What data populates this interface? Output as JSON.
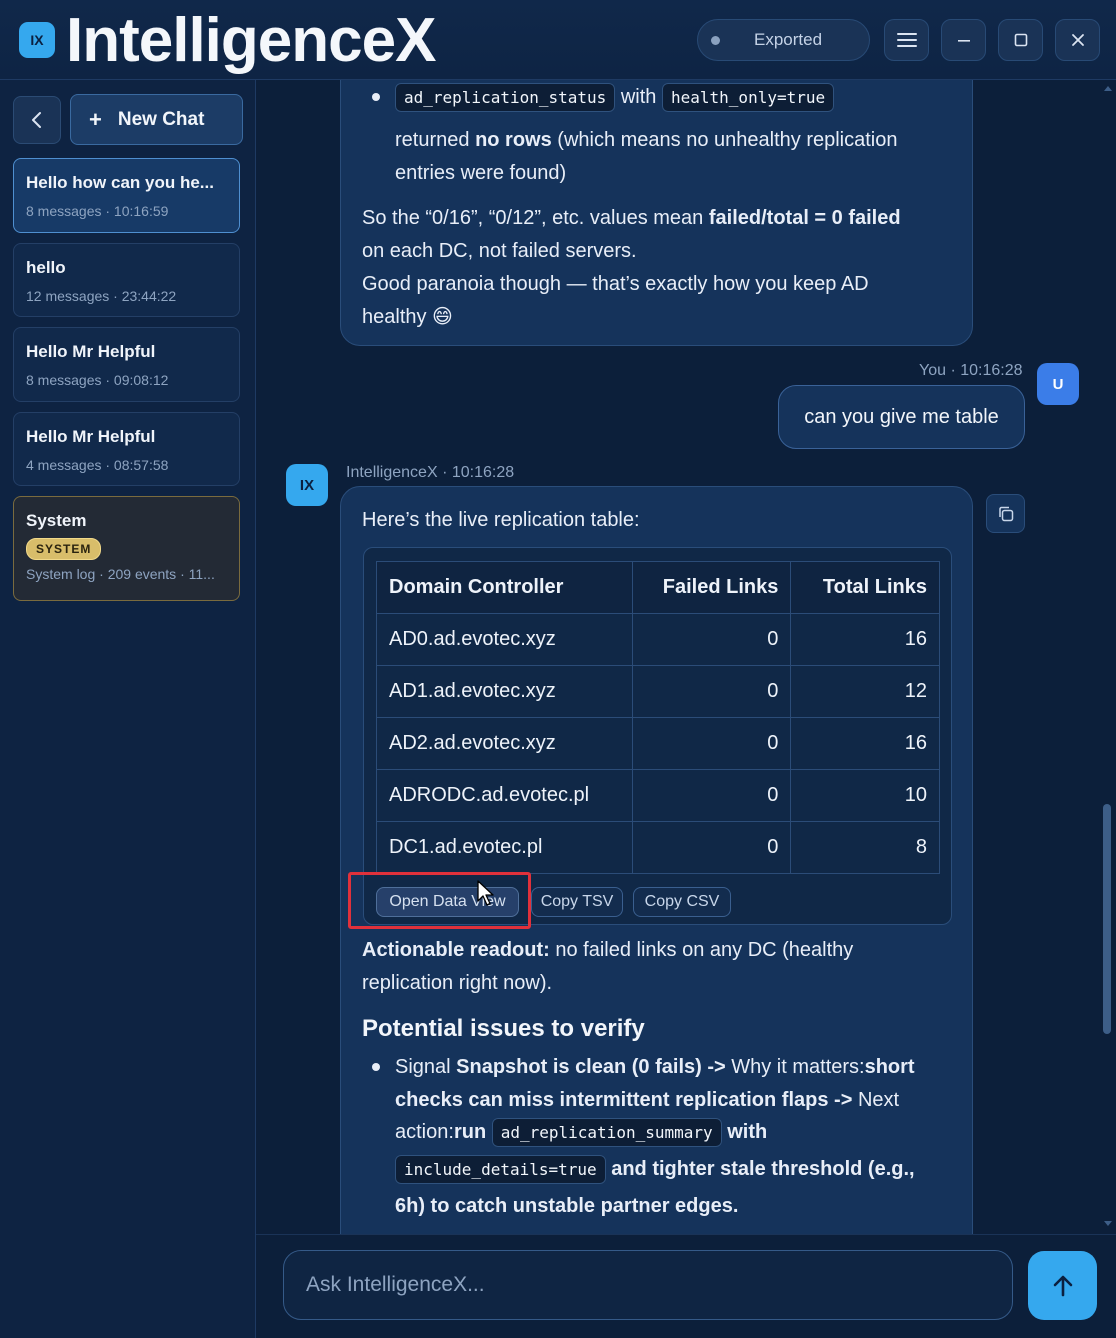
{
  "app": {
    "logo_text": "IX",
    "title": "IntelligenceX"
  },
  "status": {
    "label": "Exported"
  },
  "sidebar": {
    "new_chat_label": "New Chat",
    "items": [
      {
        "title": "Hello how can you he...",
        "meta": "8 messages · 10:16:59"
      },
      {
        "title": "hello",
        "meta": "12 messages · 23:44:22"
      },
      {
        "title": "Hello Mr Helpful",
        "meta": "8 messages · 09:08:12"
      },
      {
        "title": "Hello Mr Helpful",
        "meta": "4 messages · 08:57:58"
      },
      {
        "title": "System",
        "badge": "SYSTEM",
        "meta": "System log · 209 events · 11..."
      }
    ]
  },
  "messages": {
    "prev": {
      "code1": "ad_replication_status",
      "with": "with",
      "code2": "health_only=true",
      "t1a": "returned ",
      "t1b": "no rows",
      "t1c": " (which means no unhealthy replication",
      "t1d": "entries were found)",
      "p2a": "So the “0/16”, “0/12”, etc. values mean ",
      "p2b": "failed/total = 0 failed",
      "p2c": "on each DC, not failed servers.",
      "p3a": "Good paranoia though — that’s exactly how you keep AD",
      "p3b": "healthy 😄"
    },
    "user": {
      "meta": "You · 10:16:28",
      "avatar": "U",
      "text": "can you give me table"
    },
    "ai": {
      "avatar": "IX",
      "meta": "IntelligenceX · 10:16:28",
      "intro": "Here’s the live replication table:",
      "table": {
        "headers": [
          "Domain Controller",
          "Failed Links",
          "Total Links"
        ],
        "rows": [
          [
            "AD0.ad.evotec.xyz",
            "0",
            "16"
          ],
          [
            "AD1.ad.evotec.xyz",
            "0",
            "12"
          ],
          [
            "AD2.ad.evotec.xyz",
            "0",
            "16"
          ],
          [
            "ADRODC.ad.evotec.pl",
            "0",
            "10"
          ],
          [
            "DC1.ad.evotec.pl",
            "0",
            "8"
          ]
        ]
      },
      "buttons": {
        "open": "Open Data View",
        "tsv": "Copy TSV",
        "csv": "Copy CSV"
      },
      "readout_bold": "Actionable readout:",
      "readout_rest": " no failed links on any DC (healthy",
      "readout_line2": "replication right now).",
      "heading": "Potential issues to verify",
      "bullet": {
        "a": "Signal ",
        "b": "Snapshot is clean (0 fails)",
        "c": " -> ",
        "d": "Why it matters:",
        "e": "short",
        "f": "checks can miss intermittent replication flaps",
        "g": " -> ",
        "h": "Next",
        "i": "action:",
        "j": "run",
        "code1": "ad_replication_summary",
        "k": "with",
        "code2": "include_details=true",
        "l": "and tighter stale threshold (e.g.,",
        "m": "6h) to catch unstable partner edges."
      }
    }
  },
  "composer": {
    "placeholder": "Ask IntelligenceX..."
  }
}
